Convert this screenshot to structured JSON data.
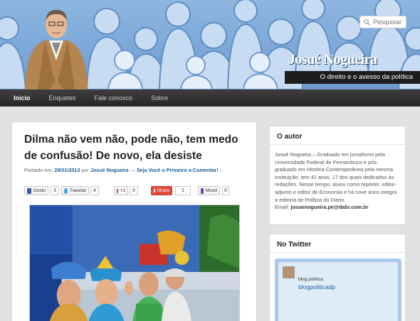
{
  "header": {
    "site_title": "Josué Nogueira",
    "site_description": "O direito e o avesso da política",
    "search_placeholder": "Pesquisar"
  },
  "nav": {
    "items": [
      "Início",
      "Enquetes",
      "Fale conosco",
      "Sobre"
    ],
    "active_index": 0
  },
  "post": {
    "title": "Dilma não vem não, pode não, tem medo de confusão! De novo, ela desiste",
    "meta_prefix": "Postado em:",
    "meta_date": "29/01/2013",
    "meta_by": "por",
    "meta_author": "Josué Nogueira",
    "meta_separator": "—",
    "meta_comment": "Seja Você o Primeiro a Comentar! ↓"
  },
  "share": {
    "facebook": {
      "label": "Gosto",
      "count": "3",
      "icon": "facebook-icon"
    },
    "twitter": {
      "label": "Tweetar",
      "count": "4",
      "icon": "twitter-bird-icon"
    },
    "gplus": {
      "label": "+1",
      "count": "0",
      "icon": "google-plus-icon"
    },
    "share": {
      "label": "Share",
      "count": "1",
      "icon": "share-icon"
    },
    "mood": {
      "label": "Mood",
      "count": "0",
      "icon": "mood-icon"
    }
  },
  "sidebar": {
    "author": {
      "title": "O autor",
      "bio": "Josué Nogueira – Graduado em jornalismo pela Universidade Federal de Pernambuco e pós-graduado em História Contemporânea pela mesma instituição, tem 41 anos, 17 dos quais dedicados às redações. Nesse tempo, atuou como repórter, editor-adjunto e editor de Economia e há nove anos integra a editoria de Política do Diario.",
      "email_label": "Email:",
      "email": "josuenogueira.pe@dabr.com.br"
    },
    "twitter": {
      "title": "No Twitter",
      "name": "blog política",
      "handle": "blogpoliticadp"
    }
  },
  "colors": {
    "header_blue": "#7aa5d6",
    "nav_dark": "#333333",
    "link_blue": "#1b5fa3",
    "twitter_frame": "#a9c8ea"
  }
}
